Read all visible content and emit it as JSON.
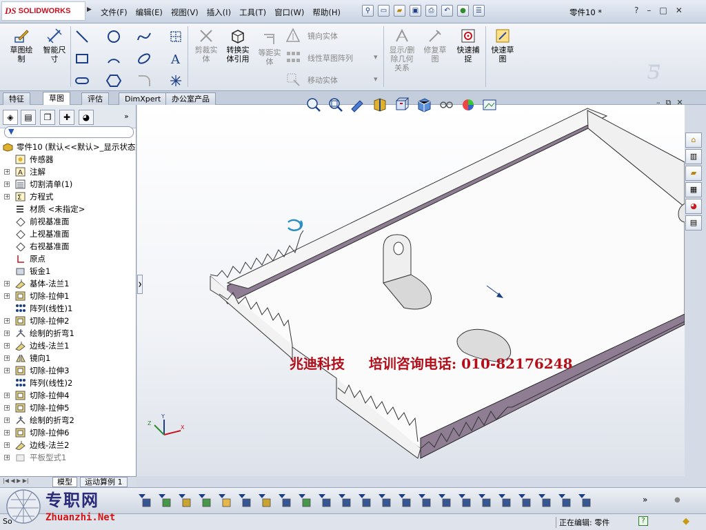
{
  "app": {
    "logo_prefix": "DS",
    "logo_text": "SOLIDWORKS",
    "doc_title": "零件10 *"
  },
  "menu": [
    "文件(F)",
    "编辑(E)",
    "视图(V)",
    "插入(I)",
    "工具(T)",
    "窗口(W)",
    "帮助(H)"
  ],
  "window_controls": {
    "help": "?",
    "minimize": "–",
    "restore": "□",
    "close": "✕"
  },
  "ribbon": {
    "sketch": "草图绘\n制",
    "smart_dim": "智能尺\n寸",
    "trim": "剪裁实\n体",
    "convert": "转换实\n体引用",
    "offset": "等距实\n体",
    "mirror": "镜向实体",
    "linear_pattern": "线性草图阵列",
    "move": "移动实体",
    "display_relations": "显示/删\n除几何\n关系",
    "repair": "修复草\n图",
    "quick_snap": "快速捕\n捉",
    "rapid_sketch": "快速草\n图"
  },
  "tabs": [
    "特征",
    "草图",
    "评估",
    "DimXpert",
    "办公室产品"
  ],
  "active_tab": "草图",
  "tree": {
    "root": "零件10  (默认<<默认>_显示状态",
    "items": [
      {
        "label": "传感器",
        "expandable": false
      },
      {
        "label": "注解",
        "expandable": true
      },
      {
        "label": "切割清单(1)",
        "expandable": true
      },
      {
        "label": "方程式",
        "expandable": true
      },
      {
        "label": "材质 <未指定>",
        "expandable": false
      },
      {
        "label": "前视基准面",
        "expandable": false
      },
      {
        "label": "上视基准面",
        "expandable": false
      },
      {
        "label": "右视基准面",
        "expandable": false
      },
      {
        "label": "原点",
        "expandable": false
      },
      {
        "label": "钣金1",
        "expandable": false
      },
      {
        "label": "基体-法兰1",
        "expandable": true
      },
      {
        "label": "切除-拉伸1",
        "expandable": true
      },
      {
        "label": "阵列(线性)1",
        "expandable": false
      },
      {
        "label": "切除-拉伸2",
        "expandable": true
      },
      {
        "label": "绘制的折弯1",
        "expandable": true
      },
      {
        "label": "边线-法兰1",
        "expandable": true
      },
      {
        "label": "镜向1",
        "expandable": true
      },
      {
        "label": "切除-拉伸3",
        "expandable": true
      },
      {
        "label": "阵列(线性)2",
        "expandable": false
      },
      {
        "label": "切除-拉伸4",
        "expandable": true
      },
      {
        "label": "切除-拉伸5",
        "expandable": true
      },
      {
        "label": "绘制的折弯2",
        "expandable": true
      },
      {
        "label": "切除-拉伸6",
        "expandable": true
      },
      {
        "label": "边线-法兰2",
        "expandable": true
      },
      {
        "label": "平板型式1",
        "expandable": true,
        "gray": true
      }
    ]
  },
  "bottom_tabs": [
    "模型",
    "运动算例 1"
  ],
  "watermark": "兆迪科技     培训咨询电话: 010-82176248",
  "status": {
    "left": "So",
    "editing": "正在编辑: 零件",
    "help": "?"
  },
  "site": {
    "name_cn": "专职网",
    "url": "Zhuanzhi.Net"
  },
  "colors": {
    "accent_red": "#c8101e",
    "flange_purple": "#8e7d93",
    "watermark_red": "#b30f1a",
    "icon_blue": "#1b3f86"
  }
}
